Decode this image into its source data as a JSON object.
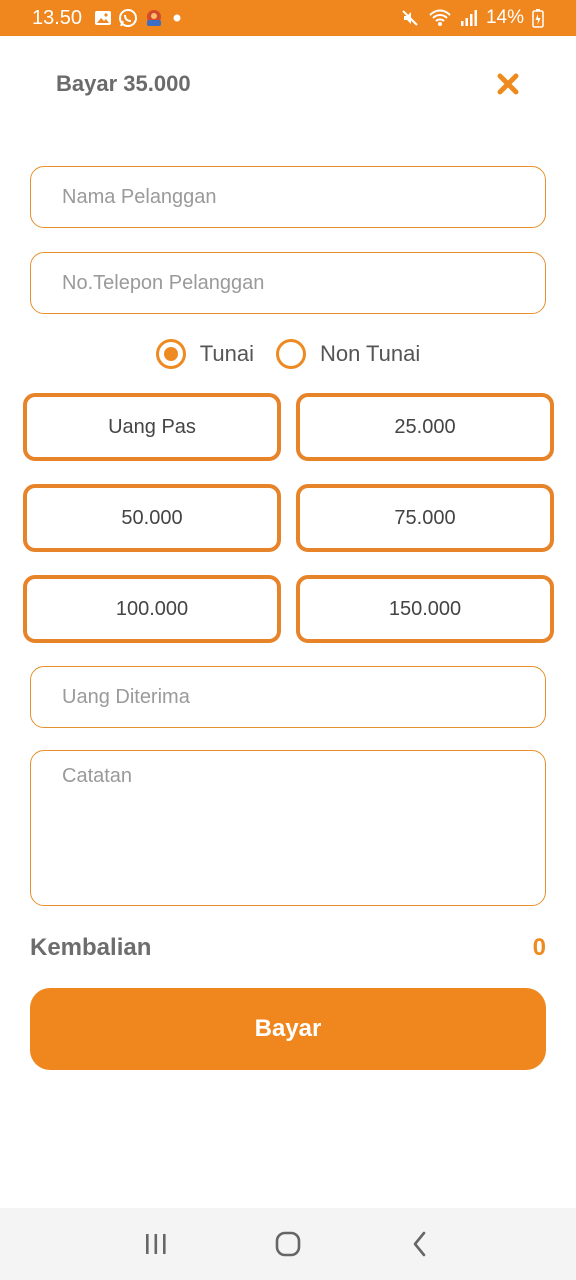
{
  "status_bar": {
    "time": "13.50",
    "battery": "14%",
    "icons": [
      "gallery-icon",
      "whatsapp-icon",
      "app-icon",
      "dot-icon",
      "mute-icon",
      "wifi-icon",
      "signal-icon",
      "battery-charging-icon"
    ]
  },
  "header": {
    "title": "Bayar 35.000",
    "close_icon": "close-icon"
  },
  "form": {
    "customer_name_placeholder": "Nama Pelanggan",
    "customer_phone_placeholder": "No.Telepon Pelanggan",
    "received_placeholder": "Uang Diterima",
    "notes_placeholder": "Catatan"
  },
  "payment_method": {
    "options": [
      {
        "label": "Tunai",
        "selected": true
      },
      {
        "label": "Non Tunai",
        "selected": false
      }
    ]
  },
  "quick_amounts": [
    "Uang Pas",
    "25.000",
    "50.000",
    "75.000",
    "100.000",
    "150.000"
  ],
  "change": {
    "label": "Kembalian",
    "value": "0"
  },
  "pay_button": {
    "label": "Bayar"
  },
  "nav_bar": {
    "icons": [
      "recent-apps-icon",
      "home-icon",
      "back-icon"
    ]
  },
  "colors": {
    "accent": "#f0871e",
    "border": "#e7902e",
    "text_muted": "#6b6b6b"
  }
}
